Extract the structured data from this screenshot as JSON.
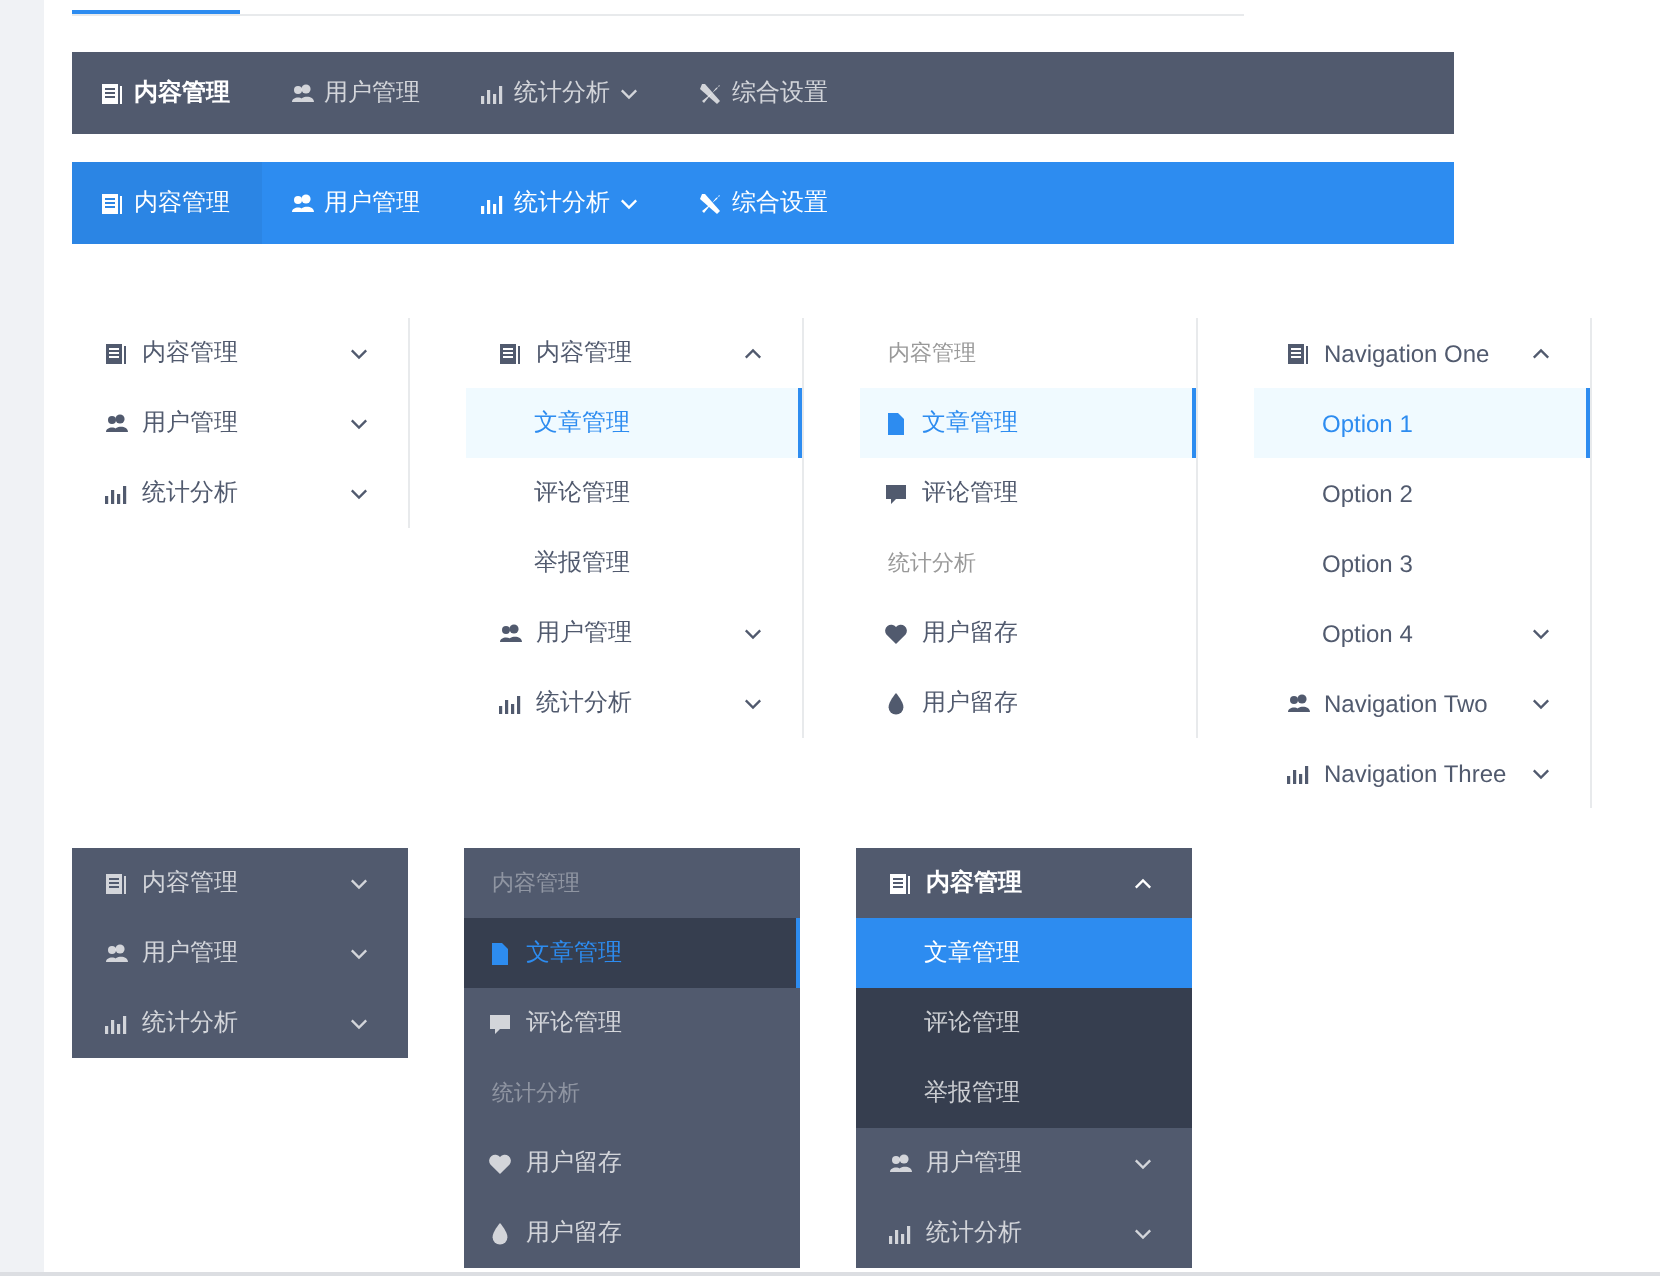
{
  "horizontal_menus": [
    {
      "kind": "dark",
      "items": [
        {
          "kind": "book",
          "label": "内容管理",
          "selected": true,
          "dropdown": false
        },
        {
          "kind": "users",
          "label": "用户管理",
          "selected": false,
          "dropdown": false
        },
        {
          "kind": "chart",
          "label": "统计分析",
          "selected": false,
          "dropdown": true
        },
        {
          "kind": "tools",
          "label": "综合设置",
          "selected": false,
          "dropdown": false
        }
      ]
    },
    {
      "kind": "primary",
      "items": [
        {
          "kind": "book",
          "label": "内容管理",
          "selected": true,
          "dropdown": false
        },
        {
          "kind": "users",
          "label": "用户管理",
          "selected": false,
          "dropdown": false
        },
        {
          "kind": "chart",
          "label": "统计分析",
          "selected": false,
          "dropdown": true
        },
        {
          "kind": "tools",
          "label": "综合设置",
          "selected": false,
          "dropdown": false
        }
      ]
    }
  ],
  "vertical_menus": [
    {
      "kind": "light",
      "items": [
        {
          "kind": "book",
          "label": "内容管理",
          "expanded": false
        },
        {
          "kind": "users",
          "label": "用户管理",
          "expanded": false
        },
        {
          "kind": "chart",
          "label": "统计分析",
          "expanded": false
        }
      ]
    },
    {
      "kind": "light",
      "items": [
        {
          "kind": "book",
          "label": "内容管理",
          "expanded": true,
          "children": [
            {
              "label": "文章管理",
              "selected": true
            },
            {
              "label": "评论管理",
              "selected": false
            },
            {
              "label": "举报管理",
              "selected": false
            }
          ]
        },
        {
          "kind": "users",
          "label": "用户管理",
          "expanded": false
        },
        {
          "kind": "chart",
          "label": "统计分析",
          "expanded": false
        }
      ]
    },
    {
      "kind": "light",
      "items": [
        {
          "label": "内容管理",
          "children": [
            {
              "kind": "file",
              "label": "文章管理",
              "selected": true
            },
            {
              "kind": "comment",
              "label": "评论管理",
              "selected": false
            }
          ]
        },
        {
          "label": "统计分析",
          "children": [
            {
              "kind": "heart",
              "label": "用户留存",
              "selected": false
            },
            {
              "kind": "drop",
              "label": "用户留存",
              "selected": false
            }
          ]
        }
      ]
    },
    {
      "kind": "light",
      "items": [
        {
          "kind": "book",
          "label": "Navigation One",
          "expanded": true,
          "children": [
            {
              "label": "Option 1",
              "selected": true
            },
            {
              "label": "Option 2",
              "selected": false
            },
            {
              "label": "Option 3",
              "selected": false
            },
            {
              "label": "Option 4",
              "expanded": false
            }
          ]
        },
        {
          "kind": "users",
          "label": "Navigation Two",
          "expanded": false
        },
        {
          "kind": "chart",
          "label": "Navigation Three",
          "expanded": false
        }
      ]
    },
    {
      "kind": "dark",
      "items": [
        {
          "kind": "book",
          "label": "内容管理",
          "expanded": false
        },
        {
          "kind": "users",
          "label": "用户管理",
          "expanded": false
        },
        {
          "kind": "chart",
          "label": "统计分析",
          "expanded": false
        }
      ]
    },
    {
      "kind": "dark",
      "items": [
        {
          "label": "内容管理",
          "children": [
            {
              "kind": "file",
              "label": "文章管理",
              "selected": true
            },
            {
              "kind": "comment",
              "label": "评论管理",
              "selected": false
            }
          ]
        },
        {
          "label": "统计分析",
          "children": [
            {
              "kind": "heart",
              "label": "用户留存",
              "selected": false
            },
            {
              "kind": "drop",
              "label": "用户留存",
              "selected": false
            }
          ]
        }
      ]
    },
    {
      "kind": "dark",
      "items": [
        {
          "kind": "book",
          "label": "内容管理",
          "expanded": true,
          "children": [
            {
              "label": "文章管理",
              "selected": true
            },
            {
              "label": "评论管理",
              "selected": false
            },
            {
              "label": "举报管理",
              "selected": false
            }
          ]
        },
        {
          "kind": "users",
          "label": "用户管理",
          "expanded": false
        },
        {
          "kind": "chart",
          "label": "统计分析",
          "expanded": false
        }
      ]
    }
  ]
}
